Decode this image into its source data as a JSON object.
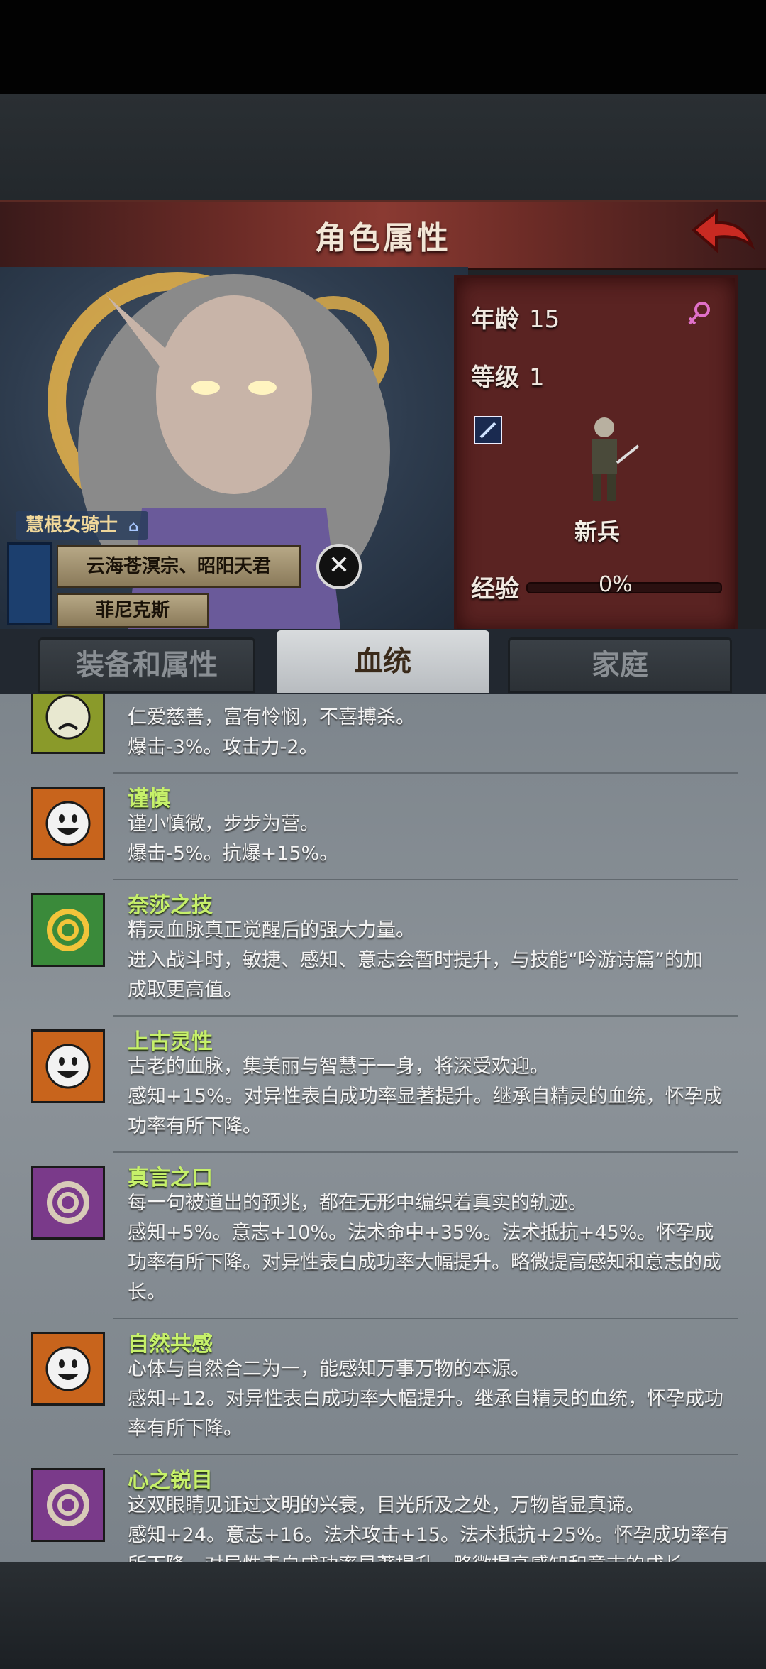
{
  "header": {
    "title": "角色属性"
  },
  "stats": {
    "age_label": "年龄",
    "age_value": "15",
    "level_label": "等级",
    "level_value": "1",
    "rank": "新兵",
    "exp_label": "经验",
    "exp_value": "0%",
    "exp_fraction": 0
  },
  "character": {
    "class": "慧根女骑士",
    "affiliation": "云海苍溟宗、昭阳天君",
    "name": "菲尼克斯"
  },
  "tabs": [
    {
      "label": "装备和属性",
      "active": false
    },
    {
      "label": "血统",
      "active": true
    },
    {
      "label": "家庭",
      "active": false
    }
  ],
  "traits": [
    {
      "name": "",
      "icon": "frown-face-icon",
      "lines": [
        "仁爱慈善，富有怜悯，不喜搏杀。",
        "爆击-3%。攻击力-2。"
      ]
    },
    {
      "name": "谨慎",
      "icon": "smile-face-icon",
      "lines": [
        "谨小慎微，步步为营。",
        "爆击-5%。抗爆+15%。"
      ]
    },
    {
      "name": "奈莎之技",
      "icon": "gold-swirl-icon",
      "lines": [
        "精灵血脉真正觉醒后的强大力量。",
        "进入战斗时，敏捷、感知、意志会暂时提升，与技能“吟游诗篇”的加",
        "成取更高值。"
      ]
    },
    {
      "name": "上古灵性",
      "icon": "smile-face-icon",
      "lines": [
        "古老的血脉，集美丽与智慧于一身，将深受欢迎。",
        "感知+15%。对异性表白成功率显著提升。继承自精灵的血统，怀孕成",
        "功率有所下降。"
      ]
    },
    {
      "name": "真言之口",
      "icon": "purple-swirl-icon",
      "lines": [
        "每一句被道出的预兆，都在无形中编织着真实的轨迹。",
        "感知+5%。意志+10%。法术命中+35%。法术抵抗+45%。怀孕成",
        "功率有所下降。对异性表白成功率大幅提升。略微提高感知和意志的成",
        "长。"
      ]
    },
    {
      "name": "自然共感",
      "icon": "smile-face-icon",
      "lines": [
        "心体与自然合二为一，能感知万事万物的本源。",
        "感知+12。对异性表白成功率大幅提升。继承自精灵的血统，怀孕成功",
        "率有所下降。"
      ]
    },
    {
      "name": "心之锐目",
      "icon": "purple-swirl-icon",
      "lines": [
        "这双眼睛见证过文明的兴衰，目光所及之处，万物皆显真谛。",
        "感知+24。意志+16。法术攻击+15。法术抵抗+25%。怀孕成功率有",
        "所下降。对异性表白成功率显著提升。略微提高感知和意志的成长。"
      ]
    }
  ],
  "colors": {
    "trait_name": "#c6f06a",
    "panel": "#5a2322",
    "title_bar": "#8a3a32"
  }
}
